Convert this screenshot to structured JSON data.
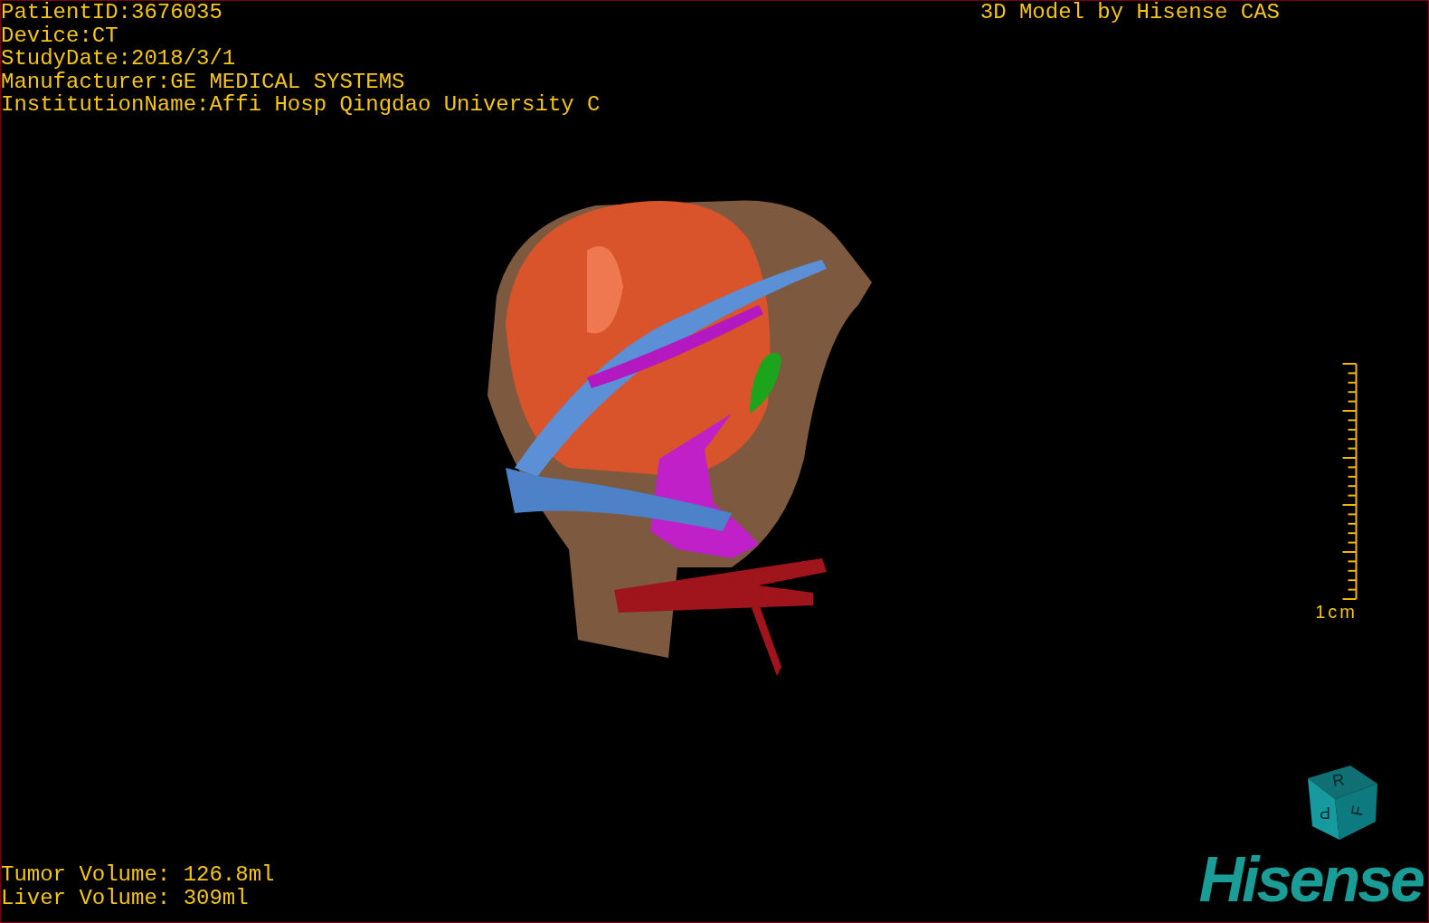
{
  "header": {
    "lines": [
      "PatientID:3676035",
      "Device:CT",
      "StudyDate:2018/3/1",
      "Manufacturer:GE MEDICAL SYSTEMS",
      "InstitutionName:Affi Hosp Qingdao University C"
    ]
  },
  "credit": "3D Model by Hisense CAS",
  "scale_bar": {
    "label": "1cm"
  },
  "volumes": [
    "Tumor Volume: 126.8ml",
    "Liver Volume: 309ml"
  ],
  "orientation_cube": {
    "faces": [
      "R",
      "P",
      "F"
    ]
  },
  "logo": "Hisense"
}
